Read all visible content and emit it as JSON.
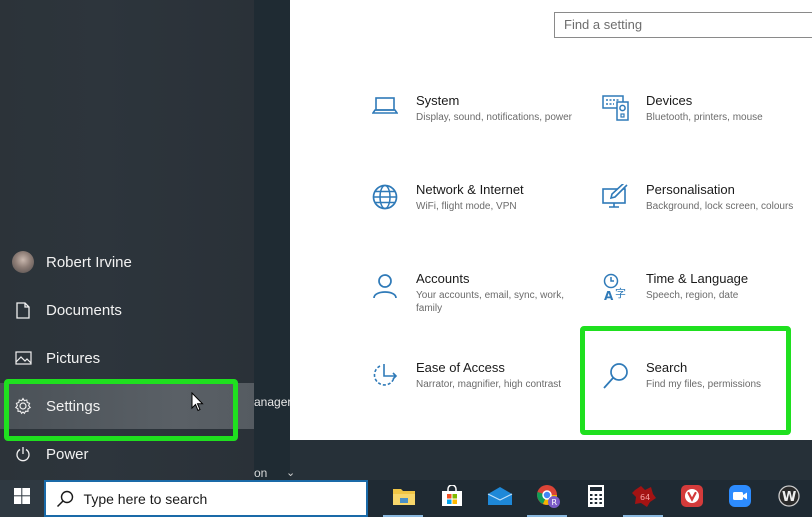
{
  "start_menu": {
    "user_name": "Robert Irvine",
    "items": [
      {
        "label": "Documents",
        "icon": "document-icon"
      },
      {
        "label": "Pictures",
        "icon": "pictures-icon"
      },
      {
        "label": "Settings",
        "icon": "gear-icon",
        "active": true
      },
      {
        "label": "Power",
        "icon": "power-icon"
      }
    ],
    "partial_text_manager": "anager",
    "partial_text_bottom": "on"
  },
  "settings": {
    "search_placeholder": "Find a setting",
    "tiles": [
      {
        "title": "System",
        "desc": "Display, sound, notifications, power",
        "icon": "laptop-icon"
      },
      {
        "title": "Devices",
        "desc": "Bluetooth, printers, mouse",
        "icon": "devices-icon"
      },
      {
        "title": "Network & Internet",
        "desc": "WiFi, flight mode, VPN",
        "icon": "globe-icon"
      },
      {
        "title": "Personalisation",
        "desc": "Background, lock screen, colours",
        "icon": "personalisation-icon"
      },
      {
        "title": "Accounts",
        "desc": "Your accounts, email, sync, work, family",
        "icon": "person-icon"
      },
      {
        "title": "Time & Language",
        "desc": "Speech, region, date",
        "icon": "time-language-icon"
      },
      {
        "title": "Ease of Access",
        "desc": "Narrator, magnifier, high contrast",
        "icon": "ease-of-access-icon"
      },
      {
        "title": "Search",
        "desc": "Find my files, permissions",
        "icon": "search-icon"
      }
    ]
  },
  "taskbar": {
    "search_placeholder": "Type here to search",
    "apps": [
      {
        "name": "File Explorer",
        "running": false
      },
      {
        "name": "Microsoft Store",
        "running": false
      },
      {
        "name": "Mail",
        "running": false
      },
      {
        "name": "Chrome",
        "running": true
      },
      {
        "name": "Calculator",
        "running": false
      },
      {
        "name": "App 64",
        "running": true
      },
      {
        "name": "Vivaldi",
        "running": false
      },
      {
        "name": "Zoom",
        "running": false
      },
      {
        "name": "App W",
        "running": false
      }
    ]
  },
  "colors": {
    "accent": "#1a6aa8",
    "highlight": "#1fe01f",
    "icon_blue": "#2f7ab8"
  }
}
